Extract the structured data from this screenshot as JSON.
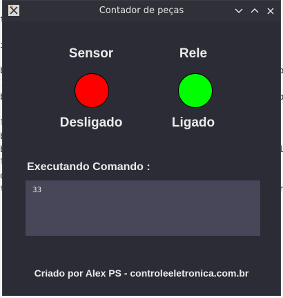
{
  "window": {
    "title": "Contador de peças"
  },
  "background_glyphs": [
    "t",
    "i",
    "b",
    ".",
    "b",
    "l",
    "b",
    "b",
    "l",
    "o",
    "t",
    "b",
    "b",
    "l",
    "r"
  ],
  "sensor": {
    "heading": "Sensor",
    "status": "Desligado",
    "color": "#ff0000"
  },
  "rele": {
    "heading": "Rele",
    "status": "Ligado",
    "color": "#00ff00"
  },
  "command": {
    "title": "Executando Comando :",
    "output": "33"
  },
  "footer": {
    "text": "Criado por Alex PS - controleeletronica.com.br"
  }
}
